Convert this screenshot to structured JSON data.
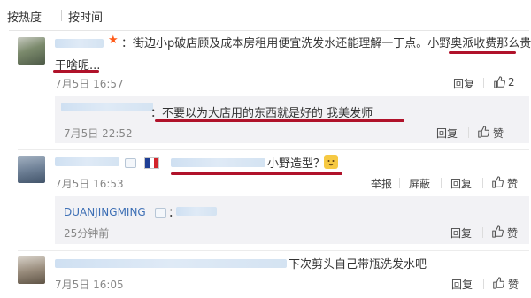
{
  "sort": {
    "hot_label": "按热度",
    "time_label": "按时间"
  },
  "comments": [
    {
      "text_line1": "：街边小p破店顾及成本房租用便宜洗发水还能理解一丁点。小野奥派收费那么贵是",
      "text_line2": "干啥呢...",
      "time": "7月5日 16:57",
      "reply_label": "回复",
      "like_count": "2",
      "replies": [
        {
          "text": "：不要以为大店用的东西就是好的 我美发师",
          "time": "7月5日 22:52",
          "reply_label": "回复",
          "like_label": "赞"
        }
      ]
    },
    {
      "text": "小野造型？",
      "time": "7月5日 16:53",
      "report_label": "举报",
      "block_label": "屏蔽",
      "reply_label": "回复",
      "like_label": "赞",
      "replies": [
        {
          "name": "DUANJINGMING",
          "text": "：",
          "time": "25分钟前",
          "reply_label": "回复",
          "like_label": "赞"
        }
      ]
    },
    {
      "text": "下次剪头自己带瓶洗发水吧",
      "time": "7月5日 16:05",
      "reply_label": "回复",
      "like_label": "赞"
    }
  ],
  "colors": {
    "highlight": "#b0122a",
    "link": "#3d6fb5",
    "muted": "#888888"
  },
  "icons": [
    "thumb-up-icon",
    "star-icon",
    "france-flag-icon",
    "member-badge-icon",
    "dog-emoji-icon"
  ]
}
